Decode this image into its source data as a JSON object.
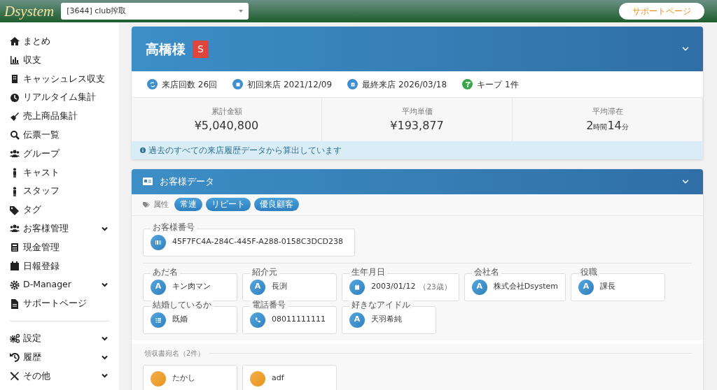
{
  "header": {
    "logo": "Dsystem",
    "store_select": "[3644] club搾取",
    "support_button": "サポートページ"
  },
  "sidebar": {
    "items": [
      {
        "label": "まとめ",
        "expandable": false
      },
      {
        "label": "収支",
        "expandable": false
      },
      {
        "label": "キャッシュレス収支",
        "expandable": false
      },
      {
        "label": "リアルタイム集計",
        "expandable": false
      },
      {
        "label": "売上商品集計",
        "expandable": false
      },
      {
        "label": "伝票一覧",
        "expandable": false
      },
      {
        "label": "グループ",
        "expandable": false
      },
      {
        "label": "キャスト",
        "expandable": false
      },
      {
        "label": "スタッフ",
        "expandable": false
      },
      {
        "label": "タグ",
        "expandable": false
      },
      {
        "label": "お客様管理",
        "expandable": true
      },
      {
        "label": "現金管理",
        "expandable": false
      },
      {
        "label": "日報登録",
        "expandable": false
      },
      {
        "label": "D-Manager",
        "expandable": true
      },
      {
        "label": "サポートページ",
        "expandable": false
      }
    ],
    "bottom_items": [
      {
        "label": "設定",
        "expandable": true
      },
      {
        "label": "履歴",
        "expandable": true
      },
      {
        "label": "その他",
        "expandable": true
      }
    ]
  },
  "customer": {
    "name": "高橋様",
    "rank": "S",
    "stats": [
      {
        "text": "来店回数 26回",
        "color": "#3f8fcc"
      },
      {
        "text": "初回来店 2021/12/09",
        "color": "#3f8fcc"
      },
      {
        "text": "最終来店 2026/03/18",
        "color": "#3f8fcc"
      },
      {
        "text": "キープ 1件",
        "color": "#3ea34a"
      }
    ],
    "summary": [
      {
        "label": "累計金額",
        "value_parts": [
          {
            "text": "¥5,040,800",
            "kind": "number"
          }
        ]
      },
      {
        "label": "平均単価",
        "value_parts": [
          {
            "text": "¥193,877",
            "kind": "number"
          }
        ]
      },
      {
        "label": "平均滞在",
        "value_parts": [
          {
            "text": "2",
            "kind": "number"
          },
          {
            "text": "時間",
            "kind": "unit"
          },
          {
            "text": "14",
            "kind": "number"
          },
          {
            "text": "分",
            "kind": "unit"
          }
        ]
      }
    ],
    "note": "過去のすべての来店履歴データから算出しています"
  },
  "customer_data": {
    "title": "お客様データ",
    "attribute_label": "属性",
    "tags": [
      "常連",
      "リピート",
      "優良顧客"
    ],
    "field_groups": [
      {
        "fields": [
          {
            "label": "お客様番号",
            "value": "45F7FC4A-284C-445F-A288-0158C3DCD238",
            "kind": "id"
          }
        ]
      },
      {
        "fields": [
          {
            "label": "あだ名",
            "value": "キン肉マン",
            "kind": "text",
            "badge": "A"
          },
          {
            "label": "紹介元",
            "value": "長渕",
            "kind": "text",
            "badge": "A"
          },
          {
            "label": "生年月日",
            "value": "2003/01/12",
            "note": "（23歳）",
            "kind": "date"
          },
          {
            "label": "会社名",
            "value": "株式会社Dsystem",
            "kind": "text",
            "badge": "A"
          },
          {
            "label": "役職",
            "value": "課長",
            "kind": "text",
            "badge": "A"
          },
          {
            "label": "結婚しているか",
            "value": "既婚",
            "kind": "list"
          },
          {
            "label": "電話番号",
            "value": "08011111111",
            "kind": "phone"
          },
          {
            "label": "好きなアイドル",
            "value": "天羽希純",
            "kind": "text",
            "badge": "A"
          }
        ]
      }
    ],
    "receipt_title": "領収書宛名（2件）",
    "receipts": [
      "たかし",
      "adf"
    ]
  }
}
